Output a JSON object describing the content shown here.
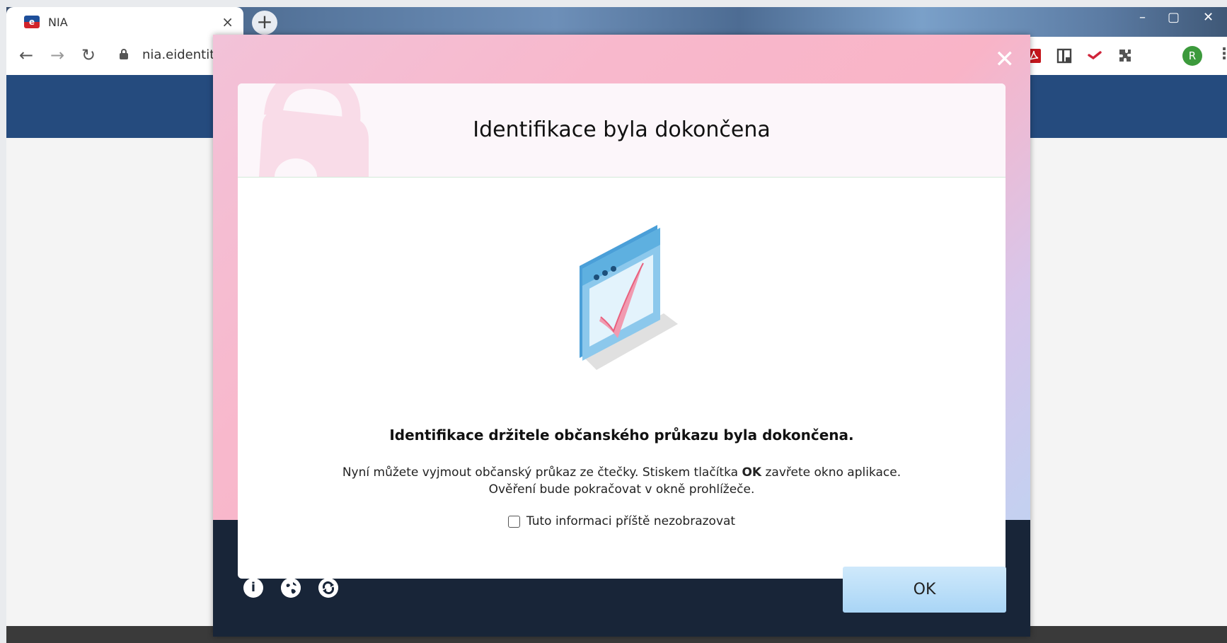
{
  "browser": {
    "tab_title": "NIA",
    "tab_close": "×",
    "new_tab": "+",
    "favicon_text": "e",
    "url": "nia.eidentita",
    "profile_initial": "R",
    "window_controls": [
      "–",
      "▢",
      "✕"
    ]
  },
  "dialog": {
    "close": "✕",
    "title": "Identifikace byla dokončena",
    "headline": "Identifikace držitele občanského průkazu byla dokončena.",
    "desc_line1_before": "Nyní můžete vyjmout občanský průkaz ze čtečky. Stiskem tlačítka ",
    "desc_line1_bold": "OK",
    "desc_line1_after": " zavřete okno aplikace.",
    "desc_line2": "Ověření bude pokračovat v okně prohlížeče.",
    "checkbox_label": "Tuto informaci příště nezobrazovat",
    "ok_label": "OK",
    "footer_icons": [
      "info-icon",
      "globe-icon",
      "refresh-icon"
    ]
  },
  "colors": {
    "page_header": "#254b7e",
    "dialog_footer": "#182538",
    "ok_button": "#a9d5f6"
  }
}
